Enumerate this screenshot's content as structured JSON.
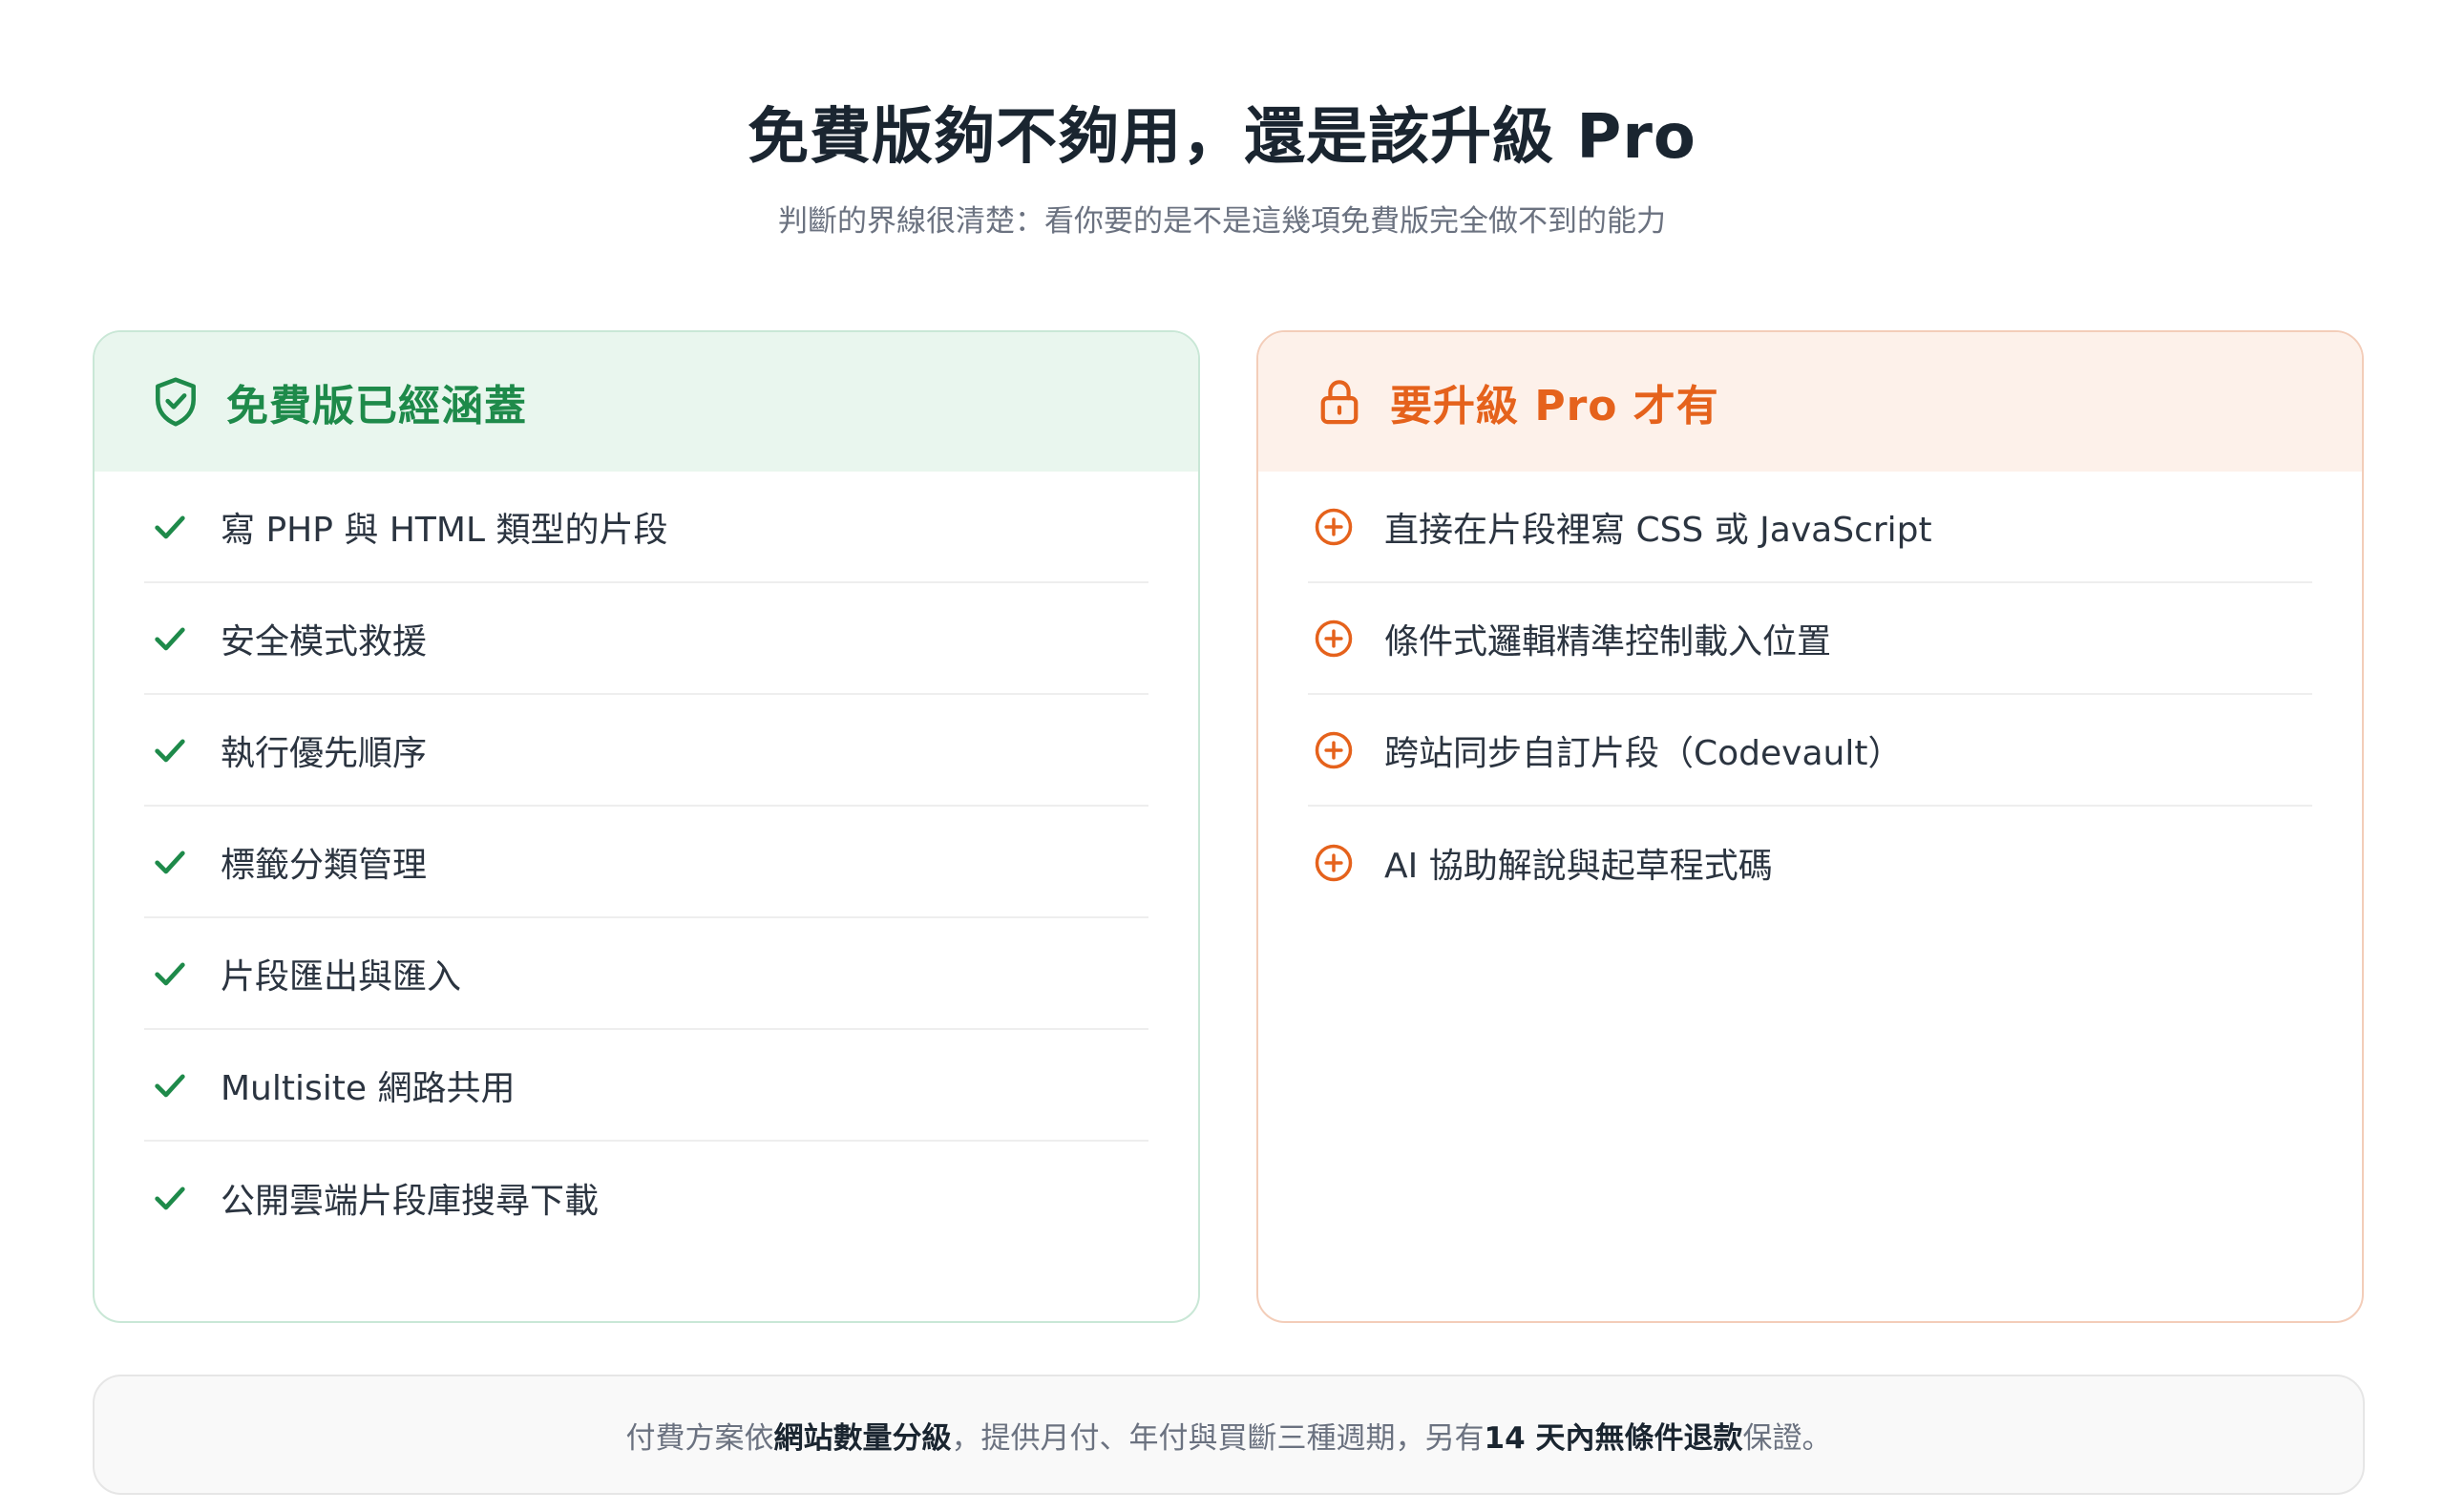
{
  "header": {
    "title": "免費版夠不夠用，還是該升級 Pro",
    "subtitle": "判斷的界線很清楚：看你要的是不是這幾項免費版完全做不到的能力"
  },
  "free": {
    "title": "免費版已經涵蓋",
    "icon": "shield-check-icon",
    "accent": "#1e8a4a",
    "items": [
      {
        "label": "寫 PHP 與 HTML 類型的片段"
      },
      {
        "label": "安全模式救援"
      },
      {
        "label": "執行優先順序"
      },
      {
        "label": "標籤分類管理"
      },
      {
        "label": "片段匯出與匯入"
      },
      {
        "label": "Multisite 網路共用"
      },
      {
        "label": "公開雲端片段庫搜尋下載"
      }
    ]
  },
  "pro": {
    "title": "要升級 Pro 才有",
    "icon": "lock-icon",
    "accent": "#e5621c",
    "items": [
      {
        "label": "直接在片段裡寫 CSS 或 JavaScript"
      },
      {
        "label": "條件式邏輯精準控制載入位置"
      },
      {
        "label": "跨站同步自訂片段（Codevault）"
      },
      {
        "label": "AI 協助解說與起草程式碼"
      }
    ]
  },
  "note": {
    "part1": "付費方案依",
    "bold1": "網站數量分級",
    "part2": "，提供月付、年付與買斷三種週期，另有 ",
    "bold2": "14 天內無條件退款",
    "part3": "保證。"
  }
}
